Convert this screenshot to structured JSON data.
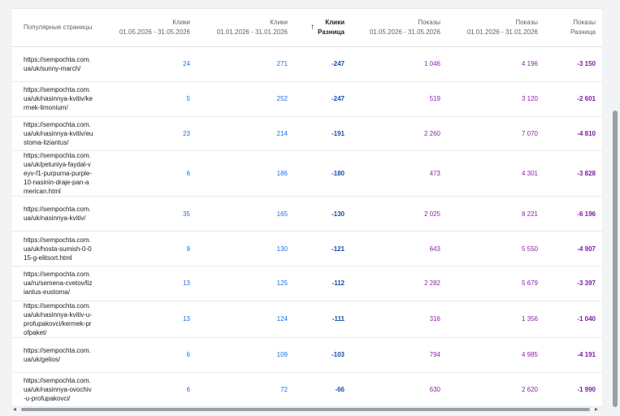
{
  "headers": {
    "page": "Популярные страницы",
    "clicks_may": [
      "Клики",
      "01.05.2026 - 31.05.2026"
    ],
    "clicks_jan": [
      "Клики",
      "01.01.2026 - 31.01.2026"
    ],
    "clicks_diff": [
      "Клики",
      "Разница"
    ],
    "impr_may": [
      "Показы",
      "01.05.2026 - 31.05.2026"
    ],
    "impr_jan": [
      "Показы",
      "01.01.2026 - 31.01.2026"
    ],
    "impr_diff": [
      "Показы",
      "Разница"
    ]
  },
  "sort_arrow": "↑",
  "rows": [
    {
      "url": "https://sempochta.com.ua/uk/sunny-march/",
      "c1": "24",
      "c2": "271",
      "cd": "-247",
      "i1": "1 046",
      "i2": "4 196",
      "id": "-3 150"
    },
    {
      "url": "https://sempochta.com.ua/uk/nasinnya-kvitiv/kermek-limonium/",
      "c1": "5",
      "c2": "252",
      "cd": "-247",
      "i1": "519",
      "i2": "3 120",
      "id": "-2 601"
    },
    {
      "url": "https://sempochta.com.ua/uk/nasinnya-kvitiv/eustoma-liziantus/",
      "c1": "23",
      "c2": "214",
      "cd": "-191",
      "i1": "2 260",
      "i2": "7 070",
      "id": "-4 810"
    },
    {
      "url": "https://sempochta.com.ua/uk/petuniya-faydal-veyv-f1-purpurna-purple-10-nasinin-draje-pan-american.html",
      "c1": "6",
      "c2": "186",
      "cd": "-180",
      "i1": "473",
      "i2": "4 301",
      "id": "-3 828"
    },
    {
      "url": "https://sempochta.com.ua/uk/nasinnya-kvitiv/",
      "c1": "35",
      "c2": "165",
      "cd": "-130",
      "i1": "2 025",
      "i2": "8 221",
      "id": "-6 196"
    },
    {
      "url": "https://sempochta.com.ua/uk/hosta-sumish-0-015-g-elitsort.html",
      "c1": "9",
      "c2": "130",
      "cd": "-121",
      "i1": "643",
      "i2": "5 550",
      "id": "-4 907"
    },
    {
      "url": "https://sempochta.com.ua/ru/semena-cvetov/liziantus-eustoma/",
      "c1": "13",
      "c2": "125",
      "cd": "-112",
      "i1": "2 282",
      "i2": "5 679",
      "id": "-3 397"
    },
    {
      "url": "https://sempochta.com.ua/uk/nasinnya-kvitiv-u-profupakovci/kermek-profpaket/",
      "c1": "13",
      "c2": "124",
      "cd": "-111",
      "i1": "316",
      "i2": "1 356",
      "id": "-1 040"
    },
    {
      "url": "https://sempochta.com.ua/uk/gelios/",
      "c1": "6",
      "c2": "109",
      "cd": "-103",
      "i1": "794",
      "i2": "4 985",
      "id": "-4 191"
    },
    {
      "url": "https://sempochta.com.ua/uk/nasinnya-ovochiv-u-profupakovci/",
      "c1": "6",
      "c2": "72",
      "cd": "-66",
      "i1": "630",
      "i2": "2 620",
      "id": "-1 990"
    }
  ],
  "scroll_left": "◂",
  "scroll_right": "▸"
}
